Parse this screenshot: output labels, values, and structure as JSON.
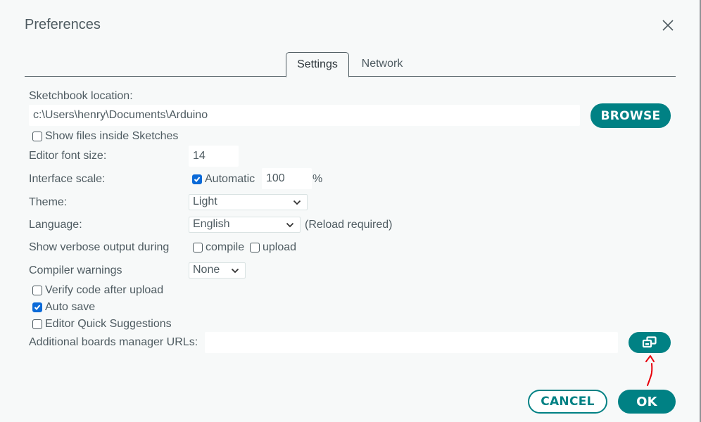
{
  "dialog": {
    "title": "Preferences",
    "close_icon": "close-icon"
  },
  "tabs": [
    {
      "label": "Settings",
      "active": true
    },
    {
      "label": "Network",
      "active": false
    }
  ],
  "settings": {
    "sketchbook": {
      "label": "Sketchbook location:",
      "value": "c:\\Users\\henry\\Documents\\Arduino",
      "browse_label": "BROWSE"
    },
    "show_files": {
      "label": "Show files inside Sketches",
      "checked": false
    },
    "editor_font_size": {
      "label": "Editor font size:",
      "value": "14"
    },
    "interface_scale": {
      "label": "Interface scale:",
      "automatic_label": "Automatic",
      "automatic_checked": true,
      "value": "100",
      "unit": "%"
    },
    "theme": {
      "label": "Theme:",
      "selected": "Light"
    },
    "language": {
      "label": "Language:",
      "selected": "English",
      "note": "(Reload required)"
    },
    "verbose": {
      "label": "Show verbose output during",
      "compile_label": "compile",
      "compile_checked": false,
      "upload_label": "upload",
      "upload_checked": false
    },
    "compiler_warnings": {
      "label": "Compiler warnings",
      "selected": "None"
    },
    "verify_after_upload": {
      "label": "Verify code after upload",
      "checked": false
    },
    "auto_save": {
      "label": "Auto save",
      "checked": true
    },
    "quick_suggestions": {
      "label": "Editor Quick Suggestions",
      "checked": false
    },
    "additional_urls": {
      "label": "Additional boards manager URLs:",
      "value": "",
      "open_editor_icon": "window-restore-icon"
    }
  },
  "footer": {
    "cancel_label": "CANCEL",
    "ok_label": "OK"
  },
  "colors": {
    "accent": "#008184",
    "checkbox_checked": "#0b6ad8",
    "text": "#4e5b61",
    "background": "#f7f9f9",
    "annotation": "#e8000b"
  }
}
